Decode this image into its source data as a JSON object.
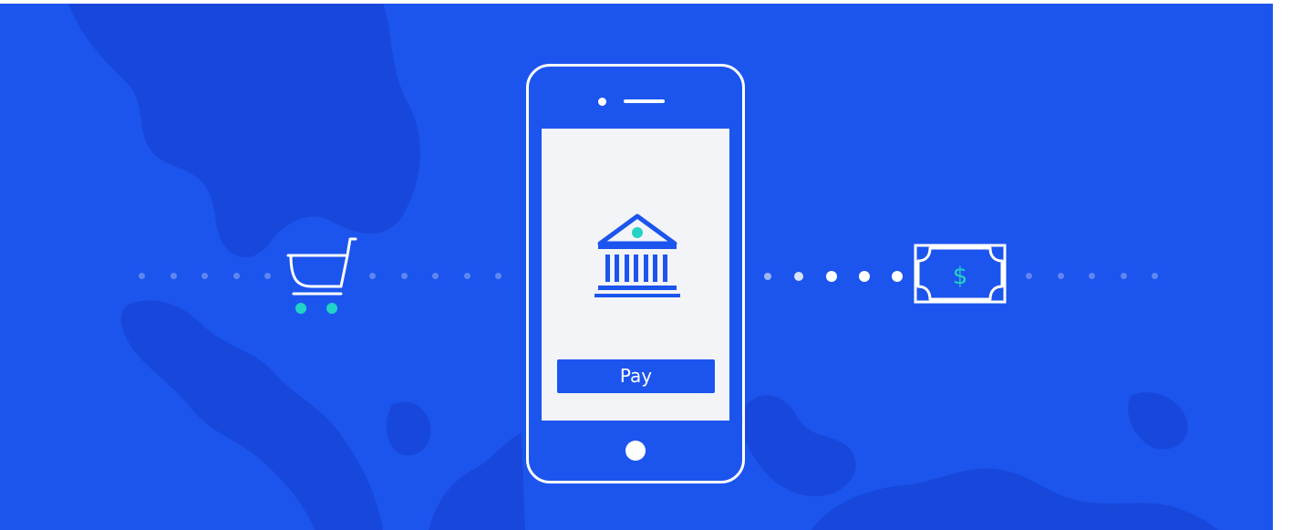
{
  "payment_flow": {
    "pay_button_label": "Pay",
    "money_symbol": "$",
    "icons": {
      "left": "shopping-cart-icon",
      "center": "bank-icon",
      "right": "banknote-icon"
    }
  },
  "colors": {
    "background": "#1c55ee",
    "map_shape": "#1848db",
    "accent": "#22d3c5",
    "phone_outline": "#ffffff",
    "screen": "#f3f4f7"
  }
}
